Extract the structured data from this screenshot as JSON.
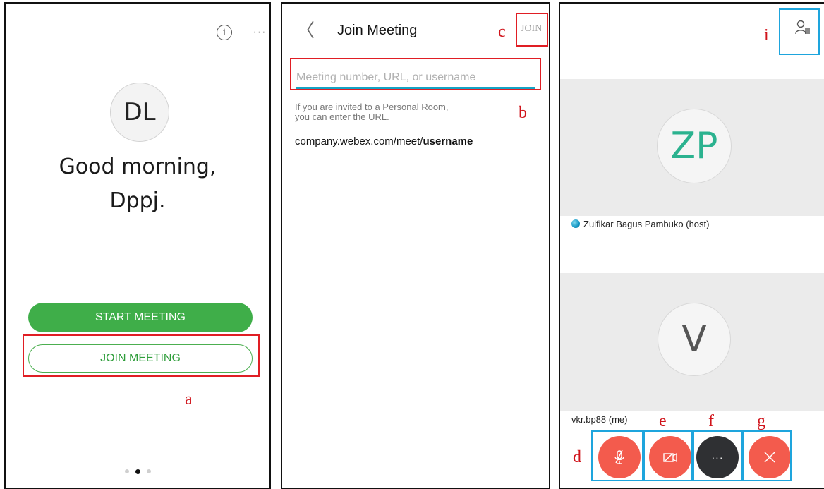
{
  "panel_home": {
    "avatar_initials": "DL",
    "greeting_line1": "Good morning,",
    "greeting_line2": "Dppj.",
    "start_meeting_label": "START MEETING",
    "join_meeting_label": "JOIN MEETING",
    "info_icon": "info-icon",
    "more_icon": "more-horizontal-icon",
    "more_glyph": "···",
    "info_glyph": "i",
    "page_dots": {
      "count": 3,
      "active_index": 1
    }
  },
  "panel_join": {
    "back_glyph": "〈",
    "title": "Join Meeting",
    "join_label": "JOIN",
    "input_placeholder": "Meeting number, URL, or username",
    "input_value": "",
    "hint_line1": "If you are invited to a Personal Room,",
    "hint_line2": "you can enter the URL.",
    "url_example_prefix": "company.webex.com/meet/",
    "url_example_bold": "username"
  },
  "panel_meeting": {
    "participants": [
      {
        "initials": "ZP",
        "name": "Zulfikar Bagus Pambuko (host)",
        "initials_color": "#2bb28f"
      },
      {
        "initials": "V",
        "name": "vkr.bp88 (me)",
        "initials_color": "#555555"
      }
    ],
    "participants_icon": "participants-list-icon",
    "controls": [
      {
        "name": "mute",
        "icon": "microphone-off-icon"
      },
      {
        "name": "video",
        "icon": "video-off-icon"
      },
      {
        "name": "more",
        "icon": "more-horizontal-icon",
        "glyph": "···"
      },
      {
        "name": "leave",
        "icon": "close-icon"
      }
    ]
  },
  "annotations": {
    "a": "a",
    "b": "b",
    "c": "c",
    "d": "d",
    "e": "e",
    "f": "f",
    "g": "g",
    "i": "i"
  },
  "colors": {
    "accent_green": "#3fae49",
    "annotation_red": "#e01e24",
    "annotation_blue": "#1ea5dd",
    "control_red": "#f35b4d",
    "control_dark": "#2f3033",
    "input_underline": "#16a3c4"
  }
}
